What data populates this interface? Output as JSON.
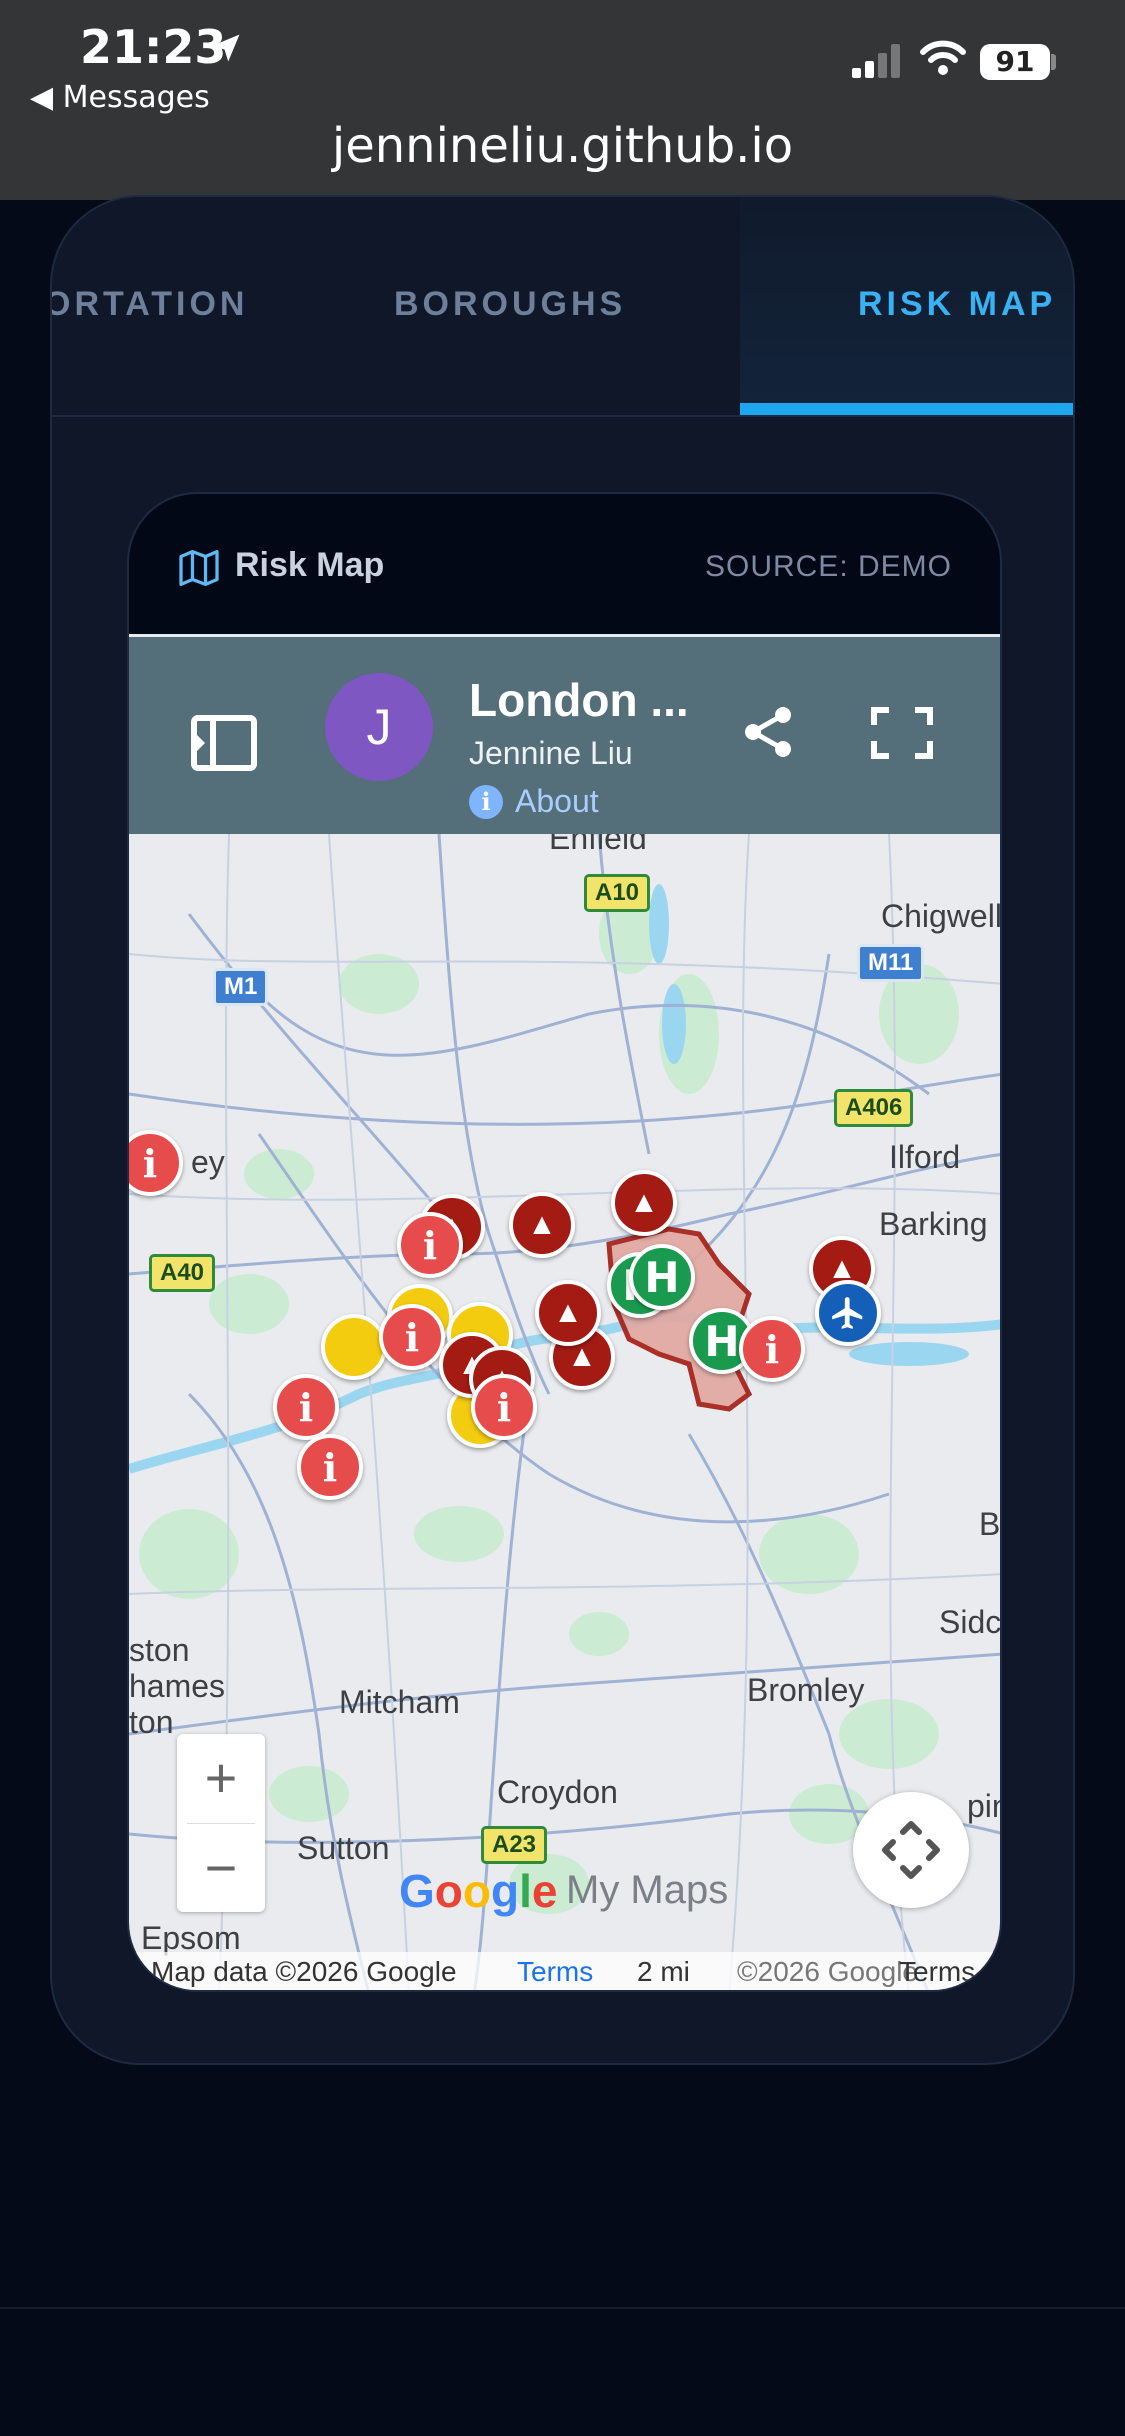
{
  "status_bar": {
    "time": "21:23",
    "back_label": "◀ Messages",
    "battery": "91"
  },
  "browser": {
    "url": "jennineliu.github.io"
  },
  "tabs": [
    {
      "label": "ORTATION"
    },
    {
      "label": "BOROUGHS"
    },
    {
      "label": "RISK MAP",
      "active": true
    }
  ],
  "panel": {
    "title": "Risk Map",
    "source": "SOURCE: DEMO"
  },
  "mymaps": {
    "avatar_letter": "J",
    "title": "London ...",
    "author": "Jennine Liu",
    "about": "About"
  },
  "map": {
    "places": [
      "Enfield",
      "Chigwell",
      "Ilford",
      "Barking",
      "Mitcham",
      "Croydon",
      "Sutton",
      "Bromley",
      "Sidc",
      "ston",
      "hames",
      "ton",
      "Epsom",
      "ey",
      "B",
      "ping"
    ],
    "roads": [
      "A10",
      "M1",
      "M11",
      "A406",
      "A40",
      "A23"
    ],
    "zoom_in": "+",
    "zoom_out": "−",
    "logo": "Google",
    "logo_suffix": "My Maps",
    "attribution": {
      "data": "Map data ©2026 Google",
      "terms": "Terms",
      "scale": "2 mi",
      "copyright": "©2026 Google",
      "terms2": "Terms"
    },
    "pin_legend": {
      "info": "i",
      "hospital": "H"
    }
  },
  "colors": {
    "accent": "#1ea7ee",
    "warn_pin": "#a31b12",
    "info_pin": "#e74c4c",
    "hospital_pin": "#1a9a4e",
    "plane_pin": "#1460b8",
    "yellow_pin": "#f3cc10"
  }
}
